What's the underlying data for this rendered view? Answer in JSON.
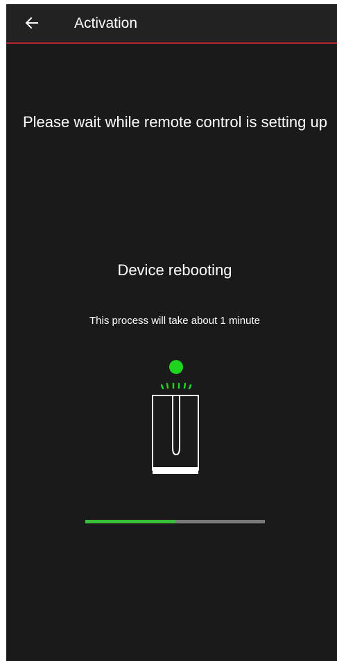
{
  "header": {
    "title": "Activation",
    "back_icon": "arrow-left-icon",
    "accent_color": "#b3262d"
  },
  "main": {
    "headline": "Please wait while remote control is setting up",
    "status_title": "Device rebooting",
    "status_subtitle": "This process will take about 1 minute",
    "device_icon": "router-device-icon",
    "status_light_color": "#1fd41f",
    "progress": 0.5,
    "progress_color": "#3bbf3b"
  }
}
